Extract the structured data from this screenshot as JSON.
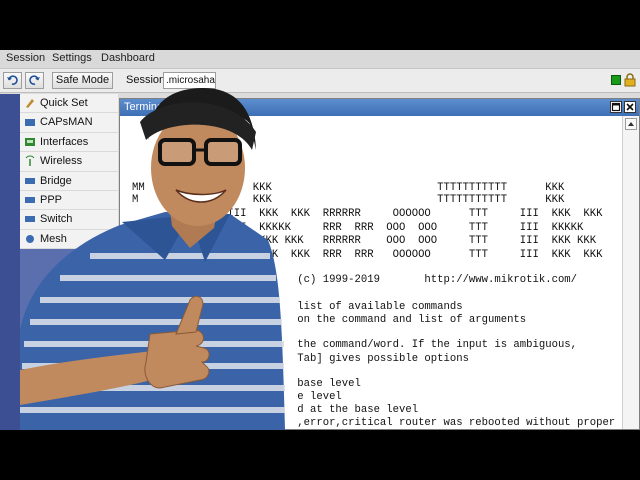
{
  "menubar": {
    "items": [
      "Session",
      "Settings",
      "Dashboard"
    ]
  },
  "toolbar": {
    "undo_icon": "undo-icon",
    "redo_icon": "redo-icon",
    "safe_mode_label": "Safe Mode",
    "session_label": "Session:",
    "session_value": ".microsahai."
  },
  "sidebar": {
    "items": [
      {
        "label": "Quick Set",
        "icon": "quick-set-icon",
        "color": "#c08a2e"
      },
      {
        "label": "CAPsMAN",
        "icon": "capsman-icon",
        "color": "#3b6bb0"
      },
      {
        "label": "Interfaces",
        "icon": "interfaces-icon",
        "color": "#2f8a2f"
      },
      {
        "label": "Wireless",
        "icon": "wireless-icon",
        "color": "#2f8a2f"
      },
      {
        "label": "Bridge",
        "icon": "bridge-icon",
        "color": "#3b6bb0"
      },
      {
        "label": "PPP",
        "icon": "ppp-icon",
        "color": "#3b6bb0"
      },
      {
        "label": "Switch",
        "icon": "switch-icon",
        "color": "#3b6bb0"
      },
      {
        "label": "Mesh",
        "icon": "mesh-icon",
        "color": "#3b6bb0"
      }
    ]
  },
  "terminal": {
    "title": "Terminal",
    "lines": [
      "MM                 KKK                          TTTTTTTTTTT      KKK",
      "M                  KKK                          TTTTTTTTTTT      KKK",
      "               III  KKK  KKK  RRRRRR     OOOOOO      TTT     III  KKK  KKK",
      "               III  KKKKK     RRR  RRR  OOO  OOO     TTT     III  KKKKK",
      "                    KKK KKK   RRRRRR    OOO  OOO     TTT     III  KKK KKK",
      "                    KKK  KKK  RRR  RRR   OOOOOO      TTT     III  KKK  KKK",
      "",
      "                          (c) 1999-2019       http://www.mikrotik.com/",
      "",
      "                          list of available commands",
      "                          on the command and list of arguments",
      "",
      "                          the command/word. If the input is ambiguous,",
      "                          Tab] gives possible options",
      "",
      "                          base level",
      "                          e level",
      "                          d at the base level",
      "                          ,error,critical router was rebooted without proper shut"
    ]
  },
  "colors": {
    "accent": "#3e6fb5",
    "sidebar": "#5b6fae",
    "status_ok": "#1a9a1a"
  }
}
